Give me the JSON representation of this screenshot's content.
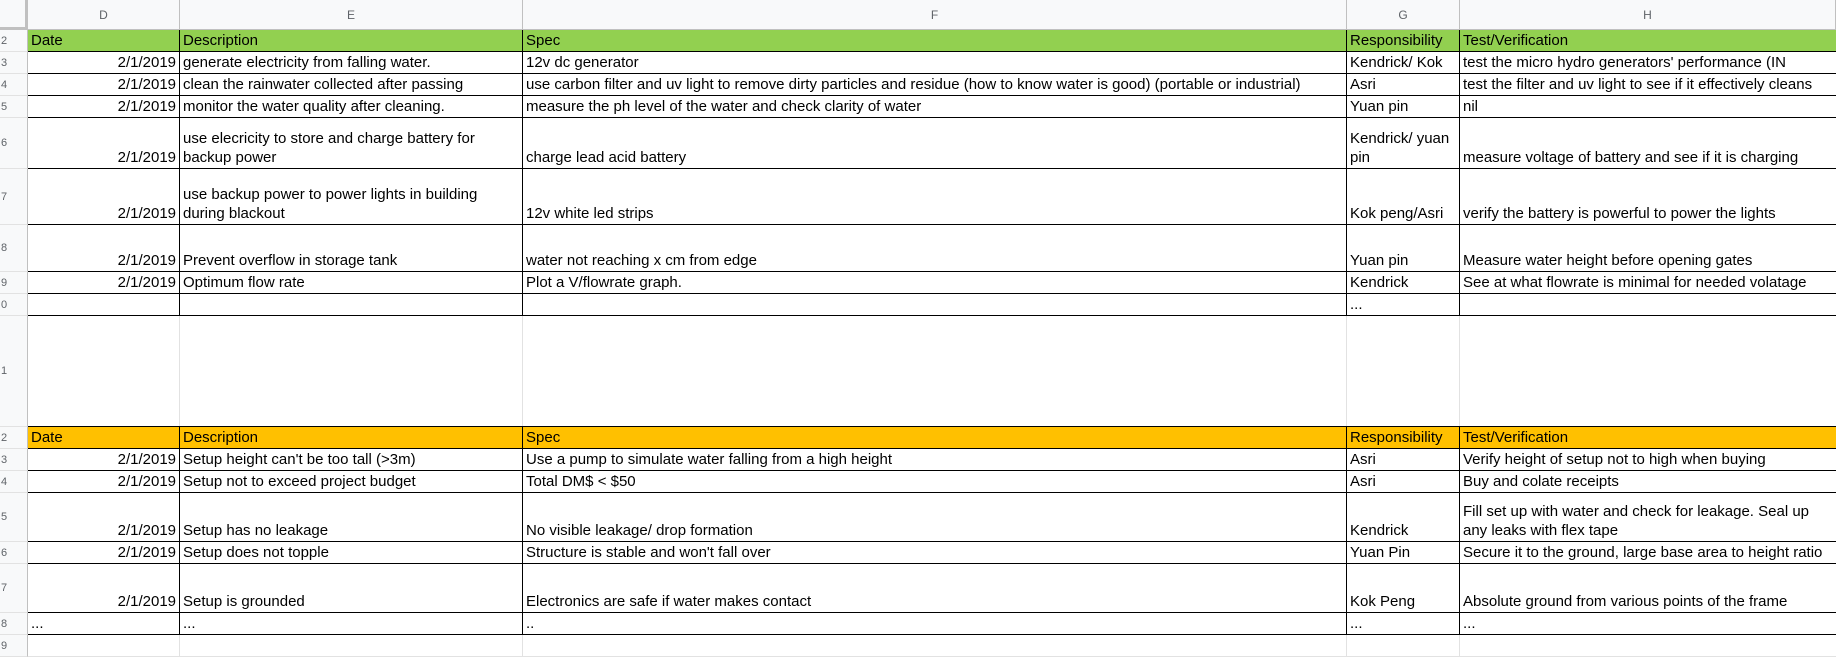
{
  "columns": [
    "D",
    "E",
    "F",
    "G",
    "H"
  ],
  "row_numbers": [
    "2",
    "3",
    "4",
    "5",
    "6",
    "7",
    "8",
    "9",
    "0",
    "1",
    "2",
    "3",
    "4",
    "5",
    "6",
    "7",
    "8",
    "9"
  ],
  "table1": {
    "header": [
      "Date",
      "Description",
      "Spec",
      "Responsibility",
      "Test/Verification"
    ],
    "header_color": "#92d050",
    "rows": [
      [
        "2/1/2019",
        "generate electricity from falling water.",
        "12v dc generator",
        "Kendrick/ Kok",
        "test the micro hydro generators' performance (IN"
      ],
      [
        "2/1/2019",
        "clean the rainwater collected after passing",
        "use carbon filter and uv light to remove dirty particles and residue (how to know water is good) (portable or industrial)",
        "Asri",
        "test the filter and uv light to see if it effectively cleans"
      ],
      [
        "2/1/2019",
        "monitor the water quality after cleaning.",
        "measure the ph level of the water and  check clarity of water",
        "Yuan pin",
        "nil"
      ],
      [
        "2/1/2019",
        "use elecricity to store and charge battery for backup power",
        "charge lead acid battery",
        "Kendrick/ yuan pin",
        "measure voltage of battery and see if it is charging"
      ],
      [
        "2/1/2019",
        "use backup power to power lights in building during blackout",
        "12v white led strips",
        "Kok peng/Asri",
        "verify the battery is powerful to power the lights"
      ],
      [
        "2/1/2019",
        "Prevent overflow in storage tank",
        "water not reaching x cm from edge",
        "Yuan pin",
        "Measure water height before opening gates"
      ],
      [
        "2/1/2019",
        "Optimum flow rate",
        "Plot a V/flowrate graph.",
        "Kendrick",
        "See at what flowrate is minimal for needed volatage"
      ],
      [
        "",
        "",
        "",
        "...",
        ""
      ]
    ]
  },
  "table2": {
    "header": [
      "Date",
      "Description",
      "Spec",
      "Responsibility",
      "Test/Verification"
    ],
    "header_color": "#ffc000",
    "rows": [
      [
        "2/1/2019",
        "Setup height can't be too tall (>3m)",
        "Use a pump to simulate water falling from a high height",
        "Asri",
        "Verify height of setup not to high when buying"
      ],
      [
        "2/1/2019",
        "Setup not to exceed project budget",
        "Total DM$ < $50",
        "Asri",
        "Buy and colate receipts"
      ],
      [
        "2/1/2019",
        "Setup has no leakage",
        "No visible leakage/ drop formation",
        "Kendrick",
        "Fill set up with water and check for leakage. Seal up any leaks with flex tape"
      ],
      [
        "2/1/2019",
        "Setup does not topple",
        "Structure is stable and won't fall over",
        "Yuan Pin",
        "Secure it to the ground, large base area to height ratio"
      ],
      [
        "2/1/2019",
        "Setup is grounded",
        "Electronics are safe if water makes contact",
        "Kok Peng",
        "Absolute ground from various points of the frame"
      ],
      [
        "...",
        "...",
        "..",
        "...",
        "..."
      ]
    ]
  }
}
